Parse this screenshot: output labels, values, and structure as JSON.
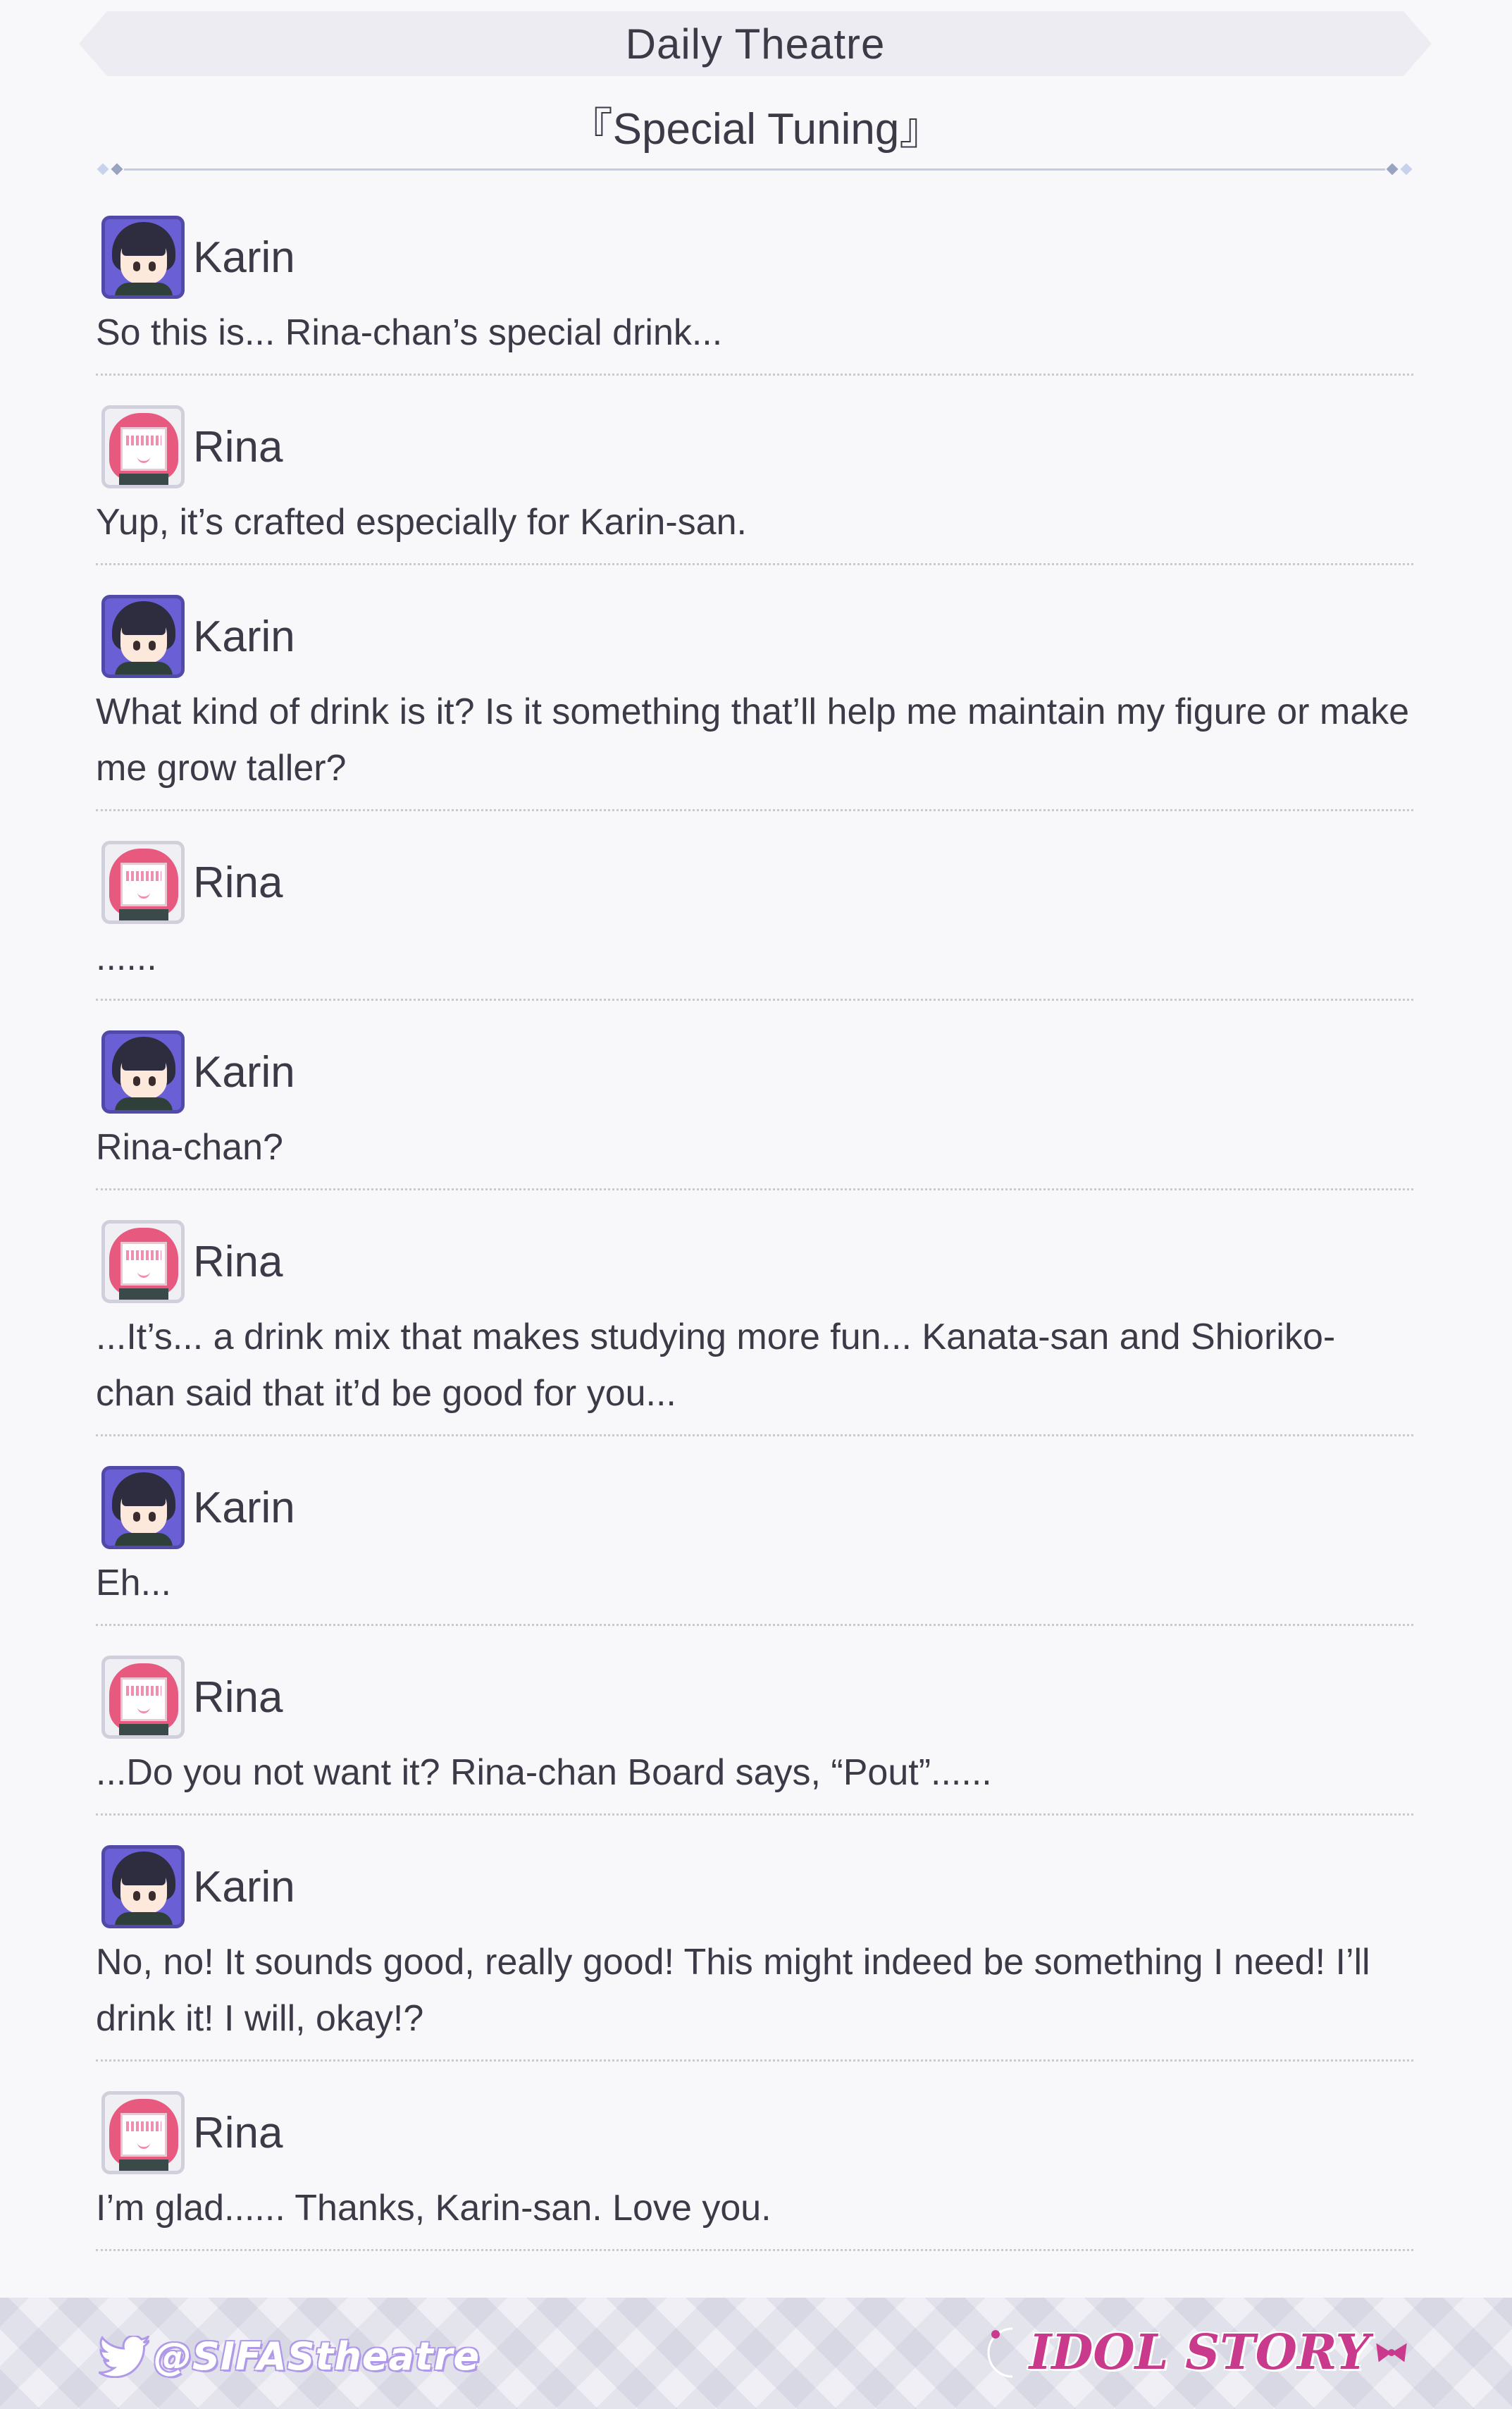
{
  "header": {
    "title": "Daily Theatre",
    "episode_title": "『Special Tuning』"
  },
  "dialogue": [
    {
      "speaker": "Karin",
      "avatar": "karin-avatar",
      "text": "So this is... Rina-chan’s special drink..."
    },
    {
      "speaker": "Rina",
      "avatar": "rina-avatar",
      "text": "Yup, it’s crafted especially for Karin-san."
    },
    {
      "speaker": "Karin",
      "avatar": "karin-avatar",
      "text": "What kind of drink is it? Is it something that’ll help me maintain my figure or make me grow taller?"
    },
    {
      "speaker": "Rina",
      "avatar": "rina-avatar",
      "text": "......"
    },
    {
      "speaker": "Karin",
      "avatar": "karin-avatar",
      "text": "Rina-chan?"
    },
    {
      "speaker": "Rina",
      "avatar": "rina-avatar",
      "text": "...It’s... a drink mix that makes studying more fun... Kanata-san and Shioriko-chan said that it’d be good for you..."
    },
    {
      "speaker": "Karin",
      "avatar": "karin-avatar",
      "text": "Eh..."
    },
    {
      "speaker": "Rina",
      "avatar": "rina-avatar",
      "text": "...Do you not want it? Rina-chan Board says, “Pout”......"
    },
    {
      "speaker": "Karin",
      "avatar": "karin-avatar",
      "text": "No, no! It sounds good, really good! This might indeed be something I need! I’ll drink it! I will, okay!?"
    },
    {
      "speaker": "Rina",
      "avatar": "rina-avatar",
      "text": "I’m glad...... Thanks, Karin-san. Love you."
    }
  ],
  "footer": {
    "twitter_handle": "@SIFAStheatre",
    "brand": "IDOL STORY",
    "twitter_icon": "twitter-bird-icon",
    "brand_icon": "crescent-moon-icon"
  },
  "colors": {
    "background": "#f8f8fb",
    "text": "#3d3a47",
    "karin_frame": "#6b5fd6",
    "rina_hair": "#e8597f",
    "brand": "#c93a8c",
    "twitter_outline": "#b09ae8"
  }
}
